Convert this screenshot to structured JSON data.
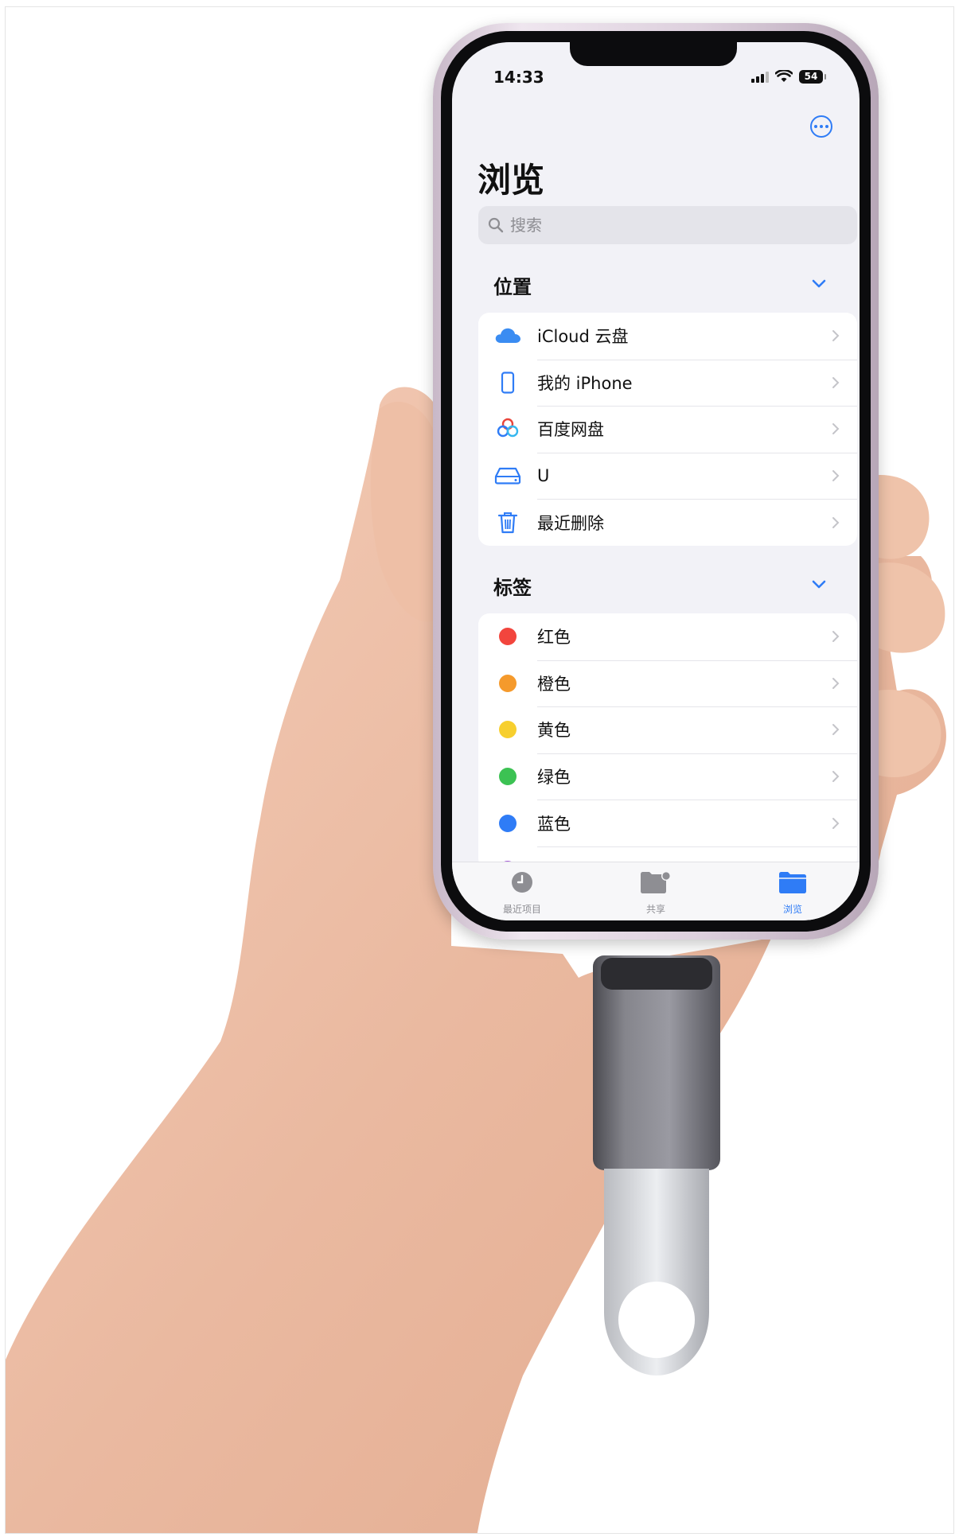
{
  "status_bar": {
    "time": "14:33",
    "battery": "54"
  },
  "page": {
    "title": "浏览"
  },
  "search": {
    "placeholder": "搜索"
  },
  "locations": {
    "header": "位置",
    "items": [
      {
        "label": "iCloud 云盘",
        "icon": "icloud-icon"
      },
      {
        "label": "我的 iPhone",
        "icon": "iphone-icon"
      },
      {
        "label": "百度网盘",
        "icon": "baidu-netdisk-icon"
      },
      {
        "label": "U",
        "icon": "drive-icon"
      },
      {
        "label": "最近删除",
        "icon": "trash-icon"
      }
    ]
  },
  "tags": {
    "header": "标签",
    "items": [
      {
        "label": "红色",
        "color": "#f2453d"
      },
      {
        "label": "橙色",
        "color": "#f59a2c"
      },
      {
        "label": "黄色",
        "color": "#f7cf2e"
      },
      {
        "label": "绿色",
        "color": "#3cc253"
      },
      {
        "label": "蓝色",
        "color": "#2f7cf6"
      },
      {
        "label": "",
        "color": "#a55ad8"
      }
    ]
  },
  "tab_bar": {
    "tabs": [
      {
        "label": "最近项目",
        "icon": "clock-icon",
        "active": false
      },
      {
        "label": "共享",
        "icon": "shared-folder-icon",
        "active": false
      },
      {
        "label": "浏览",
        "icon": "folder-icon",
        "active": true
      }
    ]
  },
  "colors": {
    "accent": "#2f7cf6",
    "inactive_tab": "#8e8e93"
  }
}
